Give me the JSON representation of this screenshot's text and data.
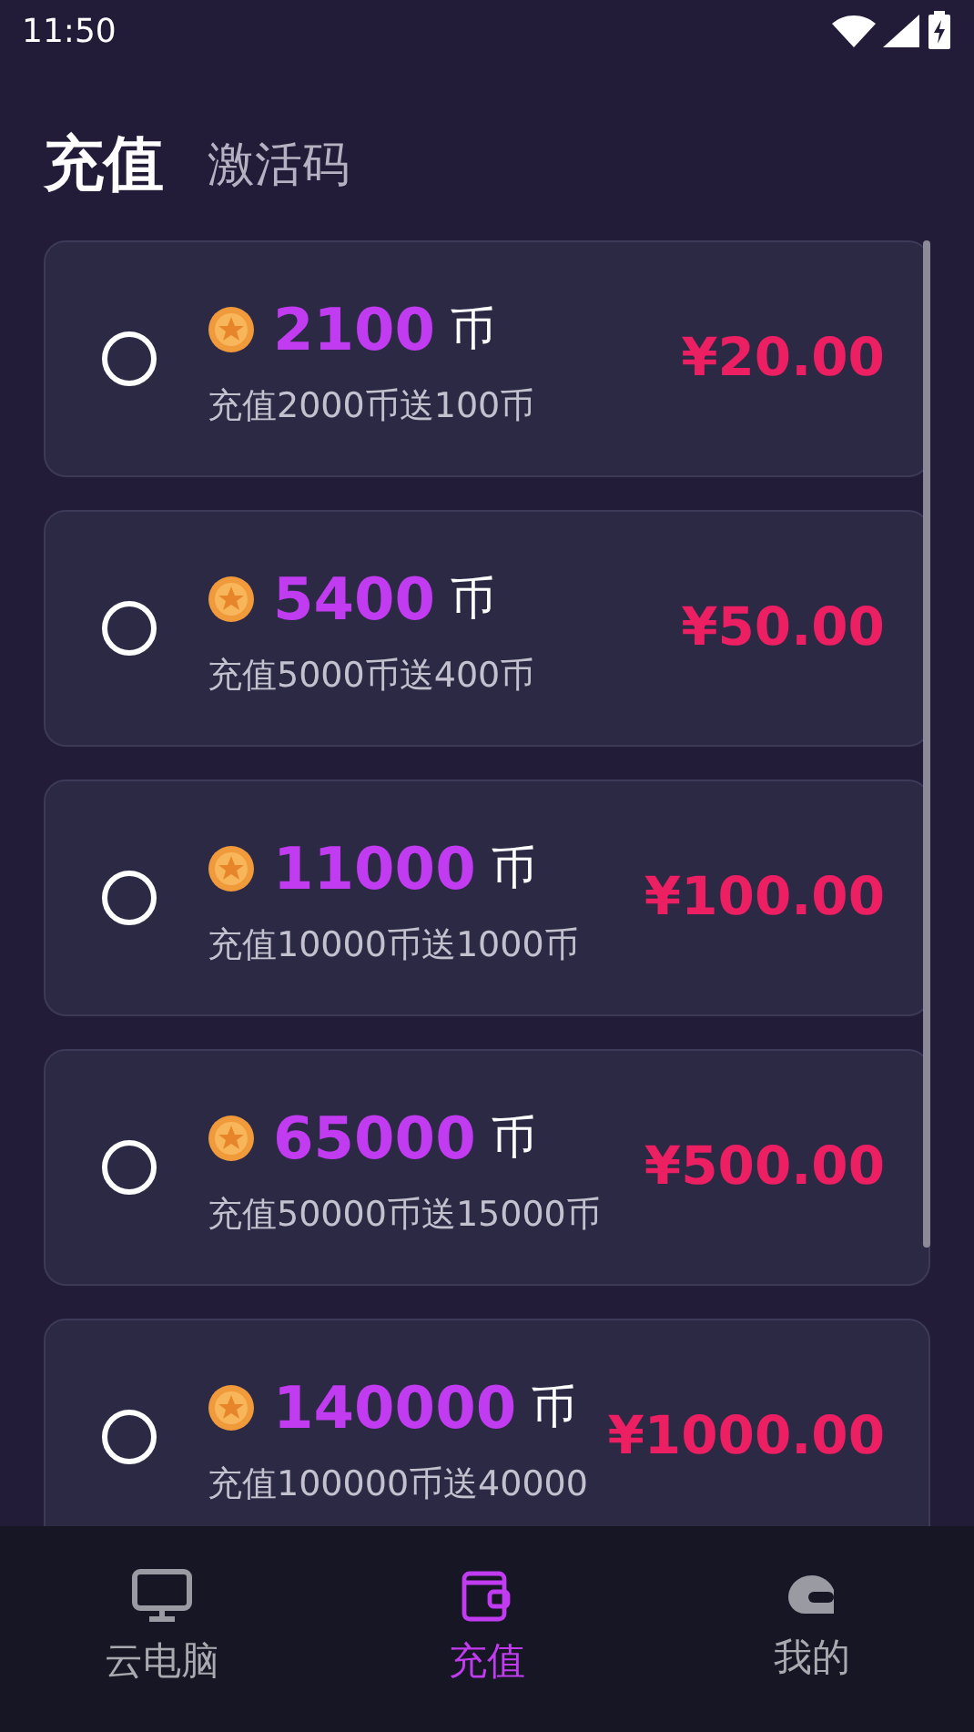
{
  "status_bar": {
    "time": "11:50"
  },
  "tabs": [
    {
      "label": "充值",
      "selected": true
    },
    {
      "label": "激活码",
      "selected": false
    }
  ],
  "packages": [
    {
      "coins": "2100",
      "unit": "币",
      "description": "充值2000币送100币",
      "price": "¥20.00",
      "selected": false
    },
    {
      "coins": "5400",
      "unit": "币",
      "description": "充值5000币送400币",
      "price": "¥50.00",
      "selected": false
    },
    {
      "coins": "11000",
      "unit": "币",
      "description": "充值10000币送1000币",
      "price": "¥100.00",
      "selected": false
    },
    {
      "coins": "65000",
      "unit": "币",
      "description": "充值50000币送15000币",
      "price": "¥500.00",
      "selected": false
    },
    {
      "coins": "140000",
      "unit": "币",
      "description": "充值100000币送40000",
      "price": "¥1000.00",
      "selected": false
    }
  ],
  "bottom_nav": [
    {
      "label": "云电脑",
      "kind": "monitor",
      "selected": false
    },
    {
      "label": "充值",
      "kind": "wallet",
      "selected": true
    },
    {
      "label": "我的",
      "kind": "helmet",
      "selected": false
    }
  ]
}
